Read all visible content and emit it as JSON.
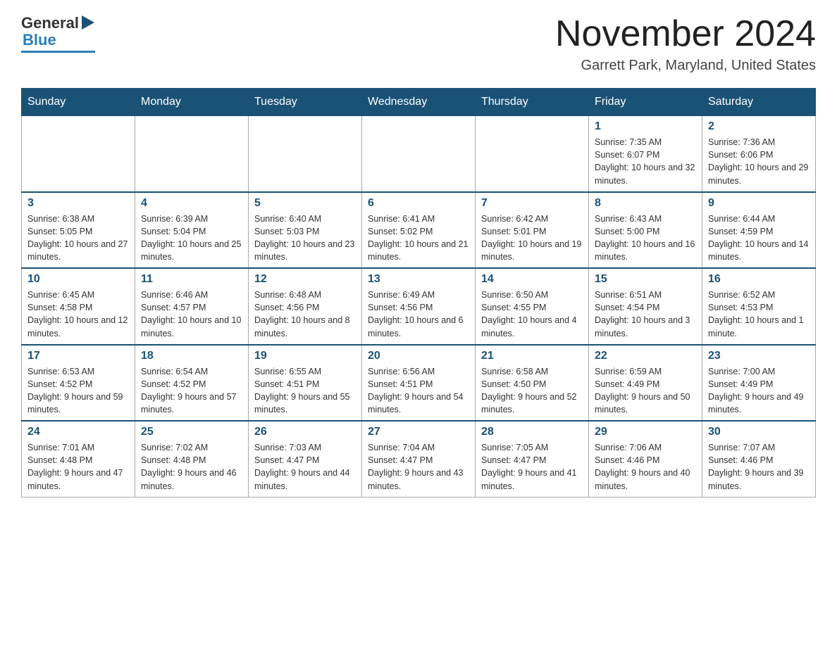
{
  "header": {
    "logo_general": "General",
    "logo_blue": "Blue",
    "month_title": "November 2024",
    "location": "Garrett Park, Maryland, United States"
  },
  "calendar": {
    "days_of_week": [
      "Sunday",
      "Monday",
      "Tuesday",
      "Wednesday",
      "Thursday",
      "Friday",
      "Saturday"
    ],
    "weeks": [
      [
        {
          "day": "",
          "info": ""
        },
        {
          "day": "",
          "info": ""
        },
        {
          "day": "",
          "info": ""
        },
        {
          "day": "",
          "info": ""
        },
        {
          "day": "",
          "info": ""
        },
        {
          "day": "1",
          "info": "Sunrise: 7:35 AM\nSunset: 6:07 PM\nDaylight: 10 hours and 32 minutes."
        },
        {
          "day": "2",
          "info": "Sunrise: 7:36 AM\nSunset: 6:06 PM\nDaylight: 10 hours and 29 minutes."
        }
      ],
      [
        {
          "day": "3",
          "info": "Sunrise: 6:38 AM\nSunset: 5:05 PM\nDaylight: 10 hours and 27 minutes."
        },
        {
          "day": "4",
          "info": "Sunrise: 6:39 AM\nSunset: 5:04 PM\nDaylight: 10 hours and 25 minutes."
        },
        {
          "day": "5",
          "info": "Sunrise: 6:40 AM\nSunset: 5:03 PM\nDaylight: 10 hours and 23 minutes."
        },
        {
          "day": "6",
          "info": "Sunrise: 6:41 AM\nSunset: 5:02 PM\nDaylight: 10 hours and 21 minutes."
        },
        {
          "day": "7",
          "info": "Sunrise: 6:42 AM\nSunset: 5:01 PM\nDaylight: 10 hours and 19 minutes."
        },
        {
          "day": "8",
          "info": "Sunrise: 6:43 AM\nSunset: 5:00 PM\nDaylight: 10 hours and 16 minutes."
        },
        {
          "day": "9",
          "info": "Sunrise: 6:44 AM\nSunset: 4:59 PM\nDaylight: 10 hours and 14 minutes."
        }
      ],
      [
        {
          "day": "10",
          "info": "Sunrise: 6:45 AM\nSunset: 4:58 PM\nDaylight: 10 hours and 12 minutes."
        },
        {
          "day": "11",
          "info": "Sunrise: 6:46 AM\nSunset: 4:57 PM\nDaylight: 10 hours and 10 minutes."
        },
        {
          "day": "12",
          "info": "Sunrise: 6:48 AM\nSunset: 4:56 PM\nDaylight: 10 hours and 8 minutes."
        },
        {
          "day": "13",
          "info": "Sunrise: 6:49 AM\nSunset: 4:56 PM\nDaylight: 10 hours and 6 minutes."
        },
        {
          "day": "14",
          "info": "Sunrise: 6:50 AM\nSunset: 4:55 PM\nDaylight: 10 hours and 4 minutes."
        },
        {
          "day": "15",
          "info": "Sunrise: 6:51 AM\nSunset: 4:54 PM\nDaylight: 10 hours and 3 minutes."
        },
        {
          "day": "16",
          "info": "Sunrise: 6:52 AM\nSunset: 4:53 PM\nDaylight: 10 hours and 1 minute."
        }
      ],
      [
        {
          "day": "17",
          "info": "Sunrise: 6:53 AM\nSunset: 4:52 PM\nDaylight: 9 hours and 59 minutes."
        },
        {
          "day": "18",
          "info": "Sunrise: 6:54 AM\nSunset: 4:52 PM\nDaylight: 9 hours and 57 minutes."
        },
        {
          "day": "19",
          "info": "Sunrise: 6:55 AM\nSunset: 4:51 PM\nDaylight: 9 hours and 55 minutes."
        },
        {
          "day": "20",
          "info": "Sunrise: 6:56 AM\nSunset: 4:51 PM\nDaylight: 9 hours and 54 minutes."
        },
        {
          "day": "21",
          "info": "Sunrise: 6:58 AM\nSunset: 4:50 PM\nDaylight: 9 hours and 52 minutes."
        },
        {
          "day": "22",
          "info": "Sunrise: 6:59 AM\nSunset: 4:49 PM\nDaylight: 9 hours and 50 minutes."
        },
        {
          "day": "23",
          "info": "Sunrise: 7:00 AM\nSunset: 4:49 PM\nDaylight: 9 hours and 49 minutes."
        }
      ],
      [
        {
          "day": "24",
          "info": "Sunrise: 7:01 AM\nSunset: 4:48 PM\nDaylight: 9 hours and 47 minutes."
        },
        {
          "day": "25",
          "info": "Sunrise: 7:02 AM\nSunset: 4:48 PM\nDaylight: 9 hours and 46 minutes."
        },
        {
          "day": "26",
          "info": "Sunrise: 7:03 AM\nSunset: 4:47 PM\nDaylight: 9 hours and 44 minutes."
        },
        {
          "day": "27",
          "info": "Sunrise: 7:04 AM\nSunset: 4:47 PM\nDaylight: 9 hours and 43 minutes."
        },
        {
          "day": "28",
          "info": "Sunrise: 7:05 AM\nSunset: 4:47 PM\nDaylight: 9 hours and 41 minutes."
        },
        {
          "day": "29",
          "info": "Sunrise: 7:06 AM\nSunset: 4:46 PM\nDaylight: 9 hours and 40 minutes."
        },
        {
          "day": "30",
          "info": "Sunrise: 7:07 AM\nSunset: 4:46 PM\nDaylight: 9 hours and 39 minutes."
        }
      ]
    ]
  }
}
